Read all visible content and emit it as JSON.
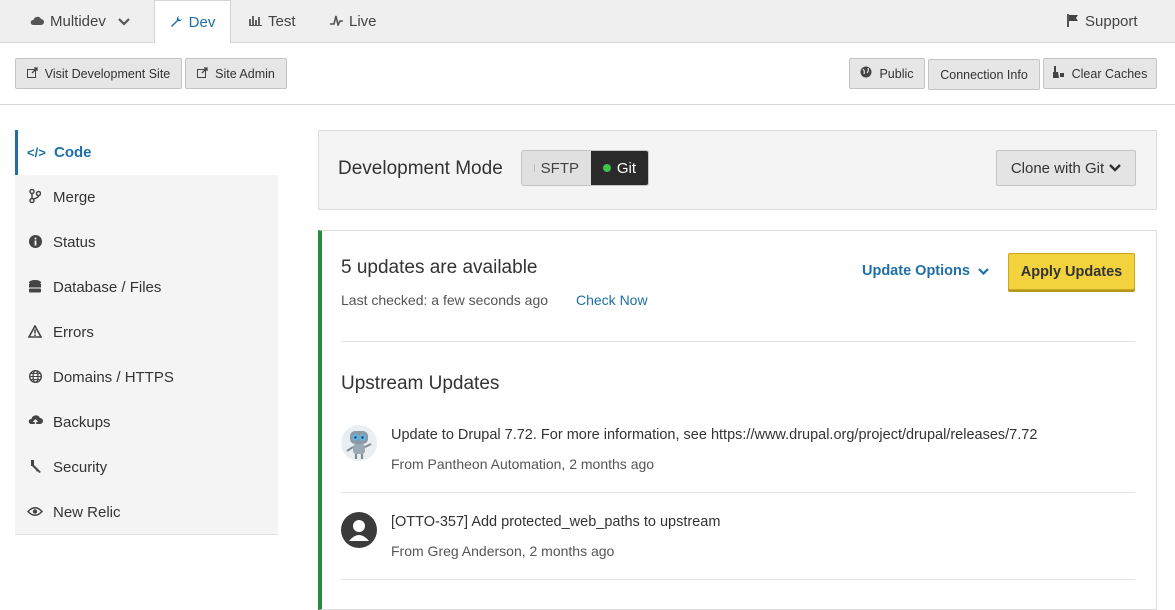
{
  "env_tabs": {
    "multidev": "Multidev",
    "dev": "Dev",
    "test": "Test",
    "live": "Live",
    "support": "Support"
  },
  "actions": {
    "visit_site": "Visit Development Site",
    "site_admin": "Site Admin",
    "public": "Public",
    "connection_info": "Connection Info",
    "clear_caches": "Clear Caches"
  },
  "sidebar": {
    "items": [
      {
        "label": "Code",
        "icon": "code-icon"
      },
      {
        "label": "Merge",
        "icon": "branch-icon"
      },
      {
        "label": "Status",
        "icon": "info-icon"
      },
      {
        "label": "Database / Files",
        "icon": "database-icon"
      },
      {
        "label": "Errors",
        "icon": "warning-icon"
      },
      {
        "label": "Domains / HTTPS",
        "icon": "globe-icon"
      },
      {
        "label": "Backups",
        "icon": "cloud-icon"
      },
      {
        "label": "Security",
        "icon": "key-icon"
      },
      {
        "label": "New Relic",
        "icon": "eye-icon"
      }
    ]
  },
  "dev_mode": {
    "title": "Development Mode",
    "sftp": "SFTP",
    "git": "Git",
    "selected": "Git",
    "clone_label": "Clone with Git"
  },
  "updates": {
    "title": "5 updates are available",
    "last_checked": "Last checked: a few seconds ago",
    "check_now": "Check Now",
    "options": "Update Options",
    "apply": "Apply Updates",
    "upstream_title": "Upstream Updates",
    "commits": [
      {
        "message": "Update to Drupal 7.72. For more information, see https://www.drupal.org/project/drupal/releases/7.72",
        "author": "From Pantheon Automation, 2 months ago"
      },
      {
        "message": "[OTTO-357] Add protected_web_paths to upstream",
        "author": "From Greg Anderson, 2 months ago"
      }
    ]
  },
  "colors": {
    "accent": "#1e6fa8",
    "apply": "#f2d33e",
    "status_green": "#27893a"
  }
}
